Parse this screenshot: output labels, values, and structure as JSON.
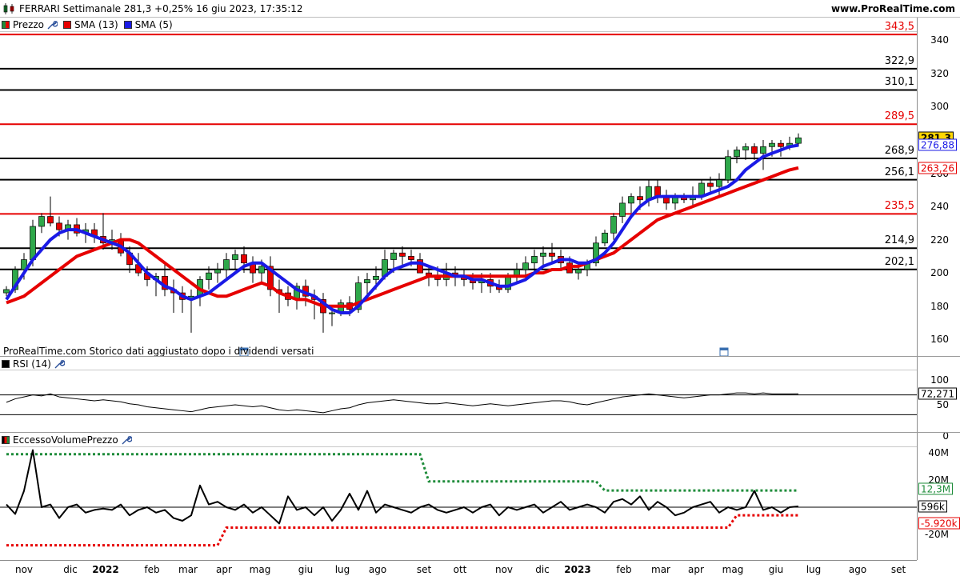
{
  "header": {
    "title": "FERRARI Settimanale 281,3 +0,25% 16 giu 2023, 17:35:12",
    "brand": "www.ProRealTime.com"
  },
  "price_panel": {
    "legend": [
      {
        "label": "Prezzo",
        "color": "#1e8c3a",
        "has_wrench": true
      },
      {
        "label": "SMA (13)",
        "color": "#e60000",
        "has_wrench": false
      },
      {
        "label": "SMA (5)",
        "color": "#1a1ae6",
        "has_wrench": false
      }
    ],
    "y_ticks": [
      "340",
      "320",
      "300",
      "280",
      "260",
      "240",
      "220",
      "200",
      "180",
      "160"
    ],
    "levels": [
      {
        "value": 343.5,
        "label": "343,5",
        "color": "#e60000"
      },
      {
        "value": 322.9,
        "label": "322,9",
        "color": "#000000"
      },
      {
        "value": 310.1,
        "label": "310,1",
        "color": "#000000"
      },
      {
        "value": 289.5,
        "label": "289,5",
        "color": "#e60000"
      },
      {
        "value": 268.9,
        "label": "268,9",
        "color": "#000000"
      },
      {
        "value": 256.1,
        "label": "256,1",
        "color": "#000000"
      },
      {
        "value": 235.5,
        "label": "235,5",
        "color": "#e60000"
      },
      {
        "value": 214.9,
        "label": "214,9",
        "color": "#000000"
      },
      {
        "value": 202.1,
        "label": "202,1",
        "color": "#000000"
      }
    ],
    "flags": [
      {
        "label": "281,3",
        "value": 281.3,
        "bg": "#ffd700",
        "border": "#000000",
        "fg": "#000000",
        "bold": true
      },
      {
        "label": "276,88",
        "value": 276.88,
        "bg": "#ffffff",
        "border": "#1a1ae6",
        "fg": "#1a1ae6",
        "bold": false
      },
      {
        "label": "263,26",
        "value": 263.26,
        "bg": "#ffffff",
        "border": "#e60000",
        "fg": "#e60000",
        "bold": false
      }
    ],
    "note": "ProRealTime.com Storico dati aggiustato dopo i dividendi versati"
  },
  "rsi_panel": {
    "legend": "RSI (14)",
    "y_ticks": [
      "100",
      "50",
      "0"
    ],
    "flag": "72,271"
  },
  "volume_panel": {
    "legend": "EccessoVolumePrezzo",
    "y_ticks": [
      "40M",
      "20M",
      "-20M"
    ],
    "flags": [
      {
        "label": "12,3M",
        "color": "#1e8c3a"
      },
      {
        "label": "596k",
        "color": "#000000"
      },
      {
        "label": "-5.920k",
        "color": "#e60000"
      }
    ]
  },
  "x_axis": [
    {
      "label": "nov",
      "bold": false
    },
    {
      "label": "dic",
      "bold": false
    },
    {
      "label": "2022",
      "bold": true
    },
    {
      "label": "feb",
      "bold": false
    },
    {
      "label": "mar",
      "bold": false
    },
    {
      "label": "apr",
      "bold": false
    },
    {
      "label": "mag",
      "bold": false
    },
    {
      "label": "giu",
      "bold": false
    },
    {
      "label": "lug",
      "bold": false
    },
    {
      "label": "ago",
      "bold": false
    },
    {
      "label": "set",
      "bold": false
    },
    {
      "label": "ott",
      "bold": false
    },
    {
      "label": "nov",
      "bold": false
    },
    {
      "label": "dic",
      "bold": false
    },
    {
      "label": "2023",
      "bold": true
    },
    {
      "label": "feb",
      "bold": false
    },
    {
      "label": "mar",
      "bold": false
    },
    {
      "label": "apr",
      "bold": false
    },
    {
      "label": "mag",
      "bold": false
    },
    {
      "label": "giu",
      "bold": false
    },
    {
      "label": "lug",
      "bold": false
    },
    {
      "label": "ago",
      "bold": false
    },
    {
      "label": "set",
      "bold": false
    }
  ],
  "chart_data": [
    {
      "type": "candlestick",
      "ylim": [
        150,
        345
      ],
      "series": [
        {
          "name": "Prezzo",
          "type": "candlestick",
          "ohlc": [
            [
              188,
              192,
              186,
              190
            ],
            [
              190,
              204,
              188,
              202
            ],
            [
              202,
              212,
              196,
              208
            ],
            [
              208,
              232,
              204,
              228
            ],
            [
              228,
              236,
              224,
              234
            ],
            [
              234,
              246,
              228,
              230
            ],
            [
              230,
              234,
              222,
              226
            ],
            [
              226,
              232,
              220,
              229
            ],
            [
              229,
              233,
              222,
              224
            ],
            [
              224,
              230,
              218,
              226
            ],
            [
              226,
              230,
              218,
              222
            ],
            [
              222,
              236,
              214,
              218
            ],
            [
              218,
              226,
              214,
              220
            ],
            [
              220,
              224,
              210,
              212
            ],
            [
              212,
              216,
              200,
              205
            ],
            [
              205,
              212,
              198,
              200
            ],
            [
              200,
              204,
              192,
              196
            ],
            [
              196,
              200,
              186,
              198
            ],
            [
              198,
              206,
              186,
              190
            ],
            [
              190,
              196,
              176,
              188
            ],
            [
              188,
              192,
              176,
              184
            ],
            [
              184,
              190,
              164,
              186
            ],
            [
              186,
              198,
              180,
              196
            ],
            [
              196,
              204,
              190,
              200
            ],
            [
              200,
              206,
              194,
              202
            ],
            [
              202,
              212,
              196,
              208
            ],
            [
              208,
              214,
              202,
              211
            ],
            [
              211,
              216,
              200,
              206
            ],
            [
              206,
              210,
              194,
              200
            ],
            [
              200,
              208,
              194,
              204
            ],
            [
              204,
              210,
              186,
              190
            ],
            [
              190,
              196,
              176,
              188
            ],
            [
              188,
              192,
              180,
              184
            ],
            [
              184,
              194,
              178,
              192
            ],
            [
              192,
              196,
              180,
              186
            ],
            [
              186,
              190,
              172,
              184
            ],
            [
              184,
              188,
              164,
              176
            ],
            [
              176,
              180,
              168,
              176
            ],
            [
              176,
              184,
              174,
              182
            ],
            [
              182,
              186,
              174,
              178
            ],
            [
              178,
              198,
              176,
              194
            ],
            [
              194,
              200,
              184,
              196
            ],
            [
              196,
              204,
              190,
              198
            ],
            [
              198,
              214,
              196,
              208
            ],
            [
              208,
              214,
              200,
              212
            ],
            [
              212,
              216,
              204,
              210
            ],
            [
              210,
              214,
              204,
              208
            ],
            [
              208,
              212,
              200,
              200
            ],
            [
              200,
              204,
              192,
              198
            ],
            [
              198,
              204,
              192,
              196
            ],
            [
              196,
              206,
              192,
              200
            ],
            [
              200,
              204,
              192,
              198
            ],
            [
              198,
              202,
              192,
              196
            ],
            [
              196,
              200,
              190,
              194
            ],
            [
              194,
              200,
              188,
              196
            ],
            [
              196,
              200,
              188,
              192
            ],
            [
              192,
              196,
              188,
              190
            ],
            [
              190,
              200,
              188,
              198
            ],
            [
              198,
              206,
              194,
              202
            ],
            [
              202,
              210,
              198,
              206
            ],
            [
              206,
              214,
              200,
              210
            ],
            [
              210,
              216,
              204,
              212
            ],
            [
              212,
              218,
              206,
              210
            ],
            [
              210,
              214,
              202,
              206
            ],
            [
              206,
              210,
              200,
              200
            ],
            [
              200,
              206,
              196,
              202
            ],
            [
              202,
              208,
              198,
              206
            ],
            [
              206,
              222,
              204,
              218
            ],
            [
              218,
              226,
              216,
              224
            ],
            [
              224,
              236,
              220,
              234
            ],
            [
              234,
              246,
              230,
              242
            ],
            [
              242,
              248,
              236,
              246
            ],
            [
              246,
              252,
              238,
              244
            ],
            [
              244,
              256,
              240,
              252
            ],
            [
              252,
              256,
              242,
              246
            ],
            [
              246,
              250,
              238,
              242
            ],
            [
              242,
              248,
              238,
              246
            ],
            [
              246,
              248,
              242,
              244
            ],
            [
              244,
              252,
              240,
              246
            ],
            [
              246,
              256,
              244,
              254
            ],
            [
              254,
              258,
              248,
              252
            ],
            [
              252,
              260,
              246,
              256
            ],
            [
              256,
              274,
              254,
              270
            ],
            [
              270,
              276,
              266,
              274
            ],
            [
              274,
              278,
              268,
              276
            ],
            [
              276,
              278,
              268,
              272
            ],
            [
              272,
              280,
              262,
              276
            ],
            [
              276,
              280,
              270,
              278
            ],
            [
              278,
              280,
              270,
              276
            ],
            [
              276,
              282,
              274,
              278
            ],
            [
              278,
              284,
              276,
              281.3
            ]
          ]
        },
        {
          "name": "SMA (13)",
          "type": "line",
          "values": [
            182,
            184,
            186,
            190,
            194,
            198,
            202,
            206,
            210,
            212,
            214,
            216,
            218,
            220,
            220,
            218,
            214,
            210,
            206,
            202,
            198,
            194,
            190,
            188,
            186,
            186,
            188,
            190,
            192,
            194,
            192,
            188,
            186,
            184,
            184,
            182,
            180,
            180,
            180,
            180,
            182,
            184,
            186,
            188,
            190,
            192,
            194,
            196,
            198,
            198,
            198,
            198,
            198,
            198,
            198,
            198,
            198,
            198,
            198,
            198,
            200,
            200,
            202,
            202,
            204,
            204,
            206,
            208,
            210,
            212,
            216,
            220,
            224,
            228,
            232,
            234,
            236,
            238,
            240,
            242,
            244,
            246,
            248,
            250,
            252,
            254,
            256,
            258,
            260,
            262,
            263.26
          ]
        },
        {
          "name": "SMA (5)",
          "type": "line",
          "values": [
            184,
            192,
            200,
            208,
            214,
            220,
            224,
            226,
            226,
            224,
            222,
            220,
            218,
            216,
            212,
            206,
            200,
            196,
            192,
            190,
            186,
            184,
            186,
            188,
            192,
            196,
            200,
            204,
            206,
            206,
            202,
            198,
            194,
            190,
            188,
            186,
            182,
            178,
            176,
            176,
            180,
            186,
            192,
            198,
            202,
            204,
            206,
            206,
            204,
            202,
            200,
            198,
            198,
            196,
            196,
            194,
            192,
            192,
            194,
            196,
            200,
            204,
            206,
            208,
            208,
            206,
            206,
            208,
            212,
            218,
            226,
            234,
            240,
            244,
            246,
            246,
            246,
            246,
            246,
            246,
            248,
            250,
            252,
            256,
            262,
            266,
            270,
            272,
            274,
            276,
            276.88
          ]
        }
      ]
    },
    {
      "type": "line",
      "name": "RSI (14)",
      "ylim": [
        0,
        100
      ],
      "values": [
        55,
        62,
        66,
        70,
        68,
        72,
        66,
        64,
        62,
        60,
        58,
        60,
        58,
        56,
        52,
        50,
        46,
        44,
        42,
        40,
        38,
        36,
        40,
        44,
        46,
        48,
        50,
        48,
        46,
        48,
        44,
        40,
        38,
        40,
        38,
        36,
        34,
        38,
        42,
        44,
        50,
        54,
        56,
        58,
        60,
        58,
        56,
        54,
        52,
        52,
        54,
        52,
        50,
        48,
        50,
        52,
        50,
        48,
        50,
        52,
        54,
        56,
        58,
        58,
        56,
        52,
        50,
        54,
        58,
        62,
        66,
        68,
        70,
        72,
        70,
        68,
        66,
        64,
        66,
        68,
        70,
        70,
        72,
        74,
        74,
        72,
        74,
        72,
        72,
        72,
        72.271
      ]
    },
    {
      "type": "line",
      "name": "EccessoVolumePrezzo",
      "ylim": [
        -30,
        50
      ],
      "values": [
        2,
        -5,
        12,
        42,
        0,
        2,
        -8,
        0,
        2,
        -4,
        -2,
        -1,
        -2,
        2,
        -6,
        -2,
        0,
        -4,
        -2,
        -8,
        -10,
        -6,
        16,
        2,
        4,
        0,
        -2,
        2,
        -4,
        0,
        -6,
        -12,
        8,
        -2,
        0,
        -6,
        0,
        -10,
        -2,
        10,
        -2,
        12,
        -4,
        2,
        0,
        -2,
        -4,
        0,
        2,
        -2,
        -4,
        -2,
        0,
        -4,
        0,
        2,
        -6,
        0,
        -2,
        0,
        2,
        -4,
        0,
        4,
        -2,
        0,
        2,
        0,
        -4,
        4,
        6,
        2,
        8,
        -2,
        4,
        0,
        -6,
        -4,
        0,
        2,
        4,
        -4,
        0,
        -2,
        0,
        12,
        -2,
        0,
        -4,
        0,
        0.596
      ],
      "upper_band": [
        {
          "from": 0,
          "to": 47,
          "value": 39
        },
        {
          "from": 47,
          "to": 67,
          "value": 19
        },
        {
          "from": 67,
          "to": 90,
          "value": 12.3
        }
      ],
      "lower_band": [
        {
          "from": 0,
          "to": 24,
          "value": -28
        },
        {
          "from": 24,
          "to": 82,
          "value": -15
        },
        {
          "from": 82,
          "to": 90,
          "value": -5.92
        }
      ]
    }
  ]
}
